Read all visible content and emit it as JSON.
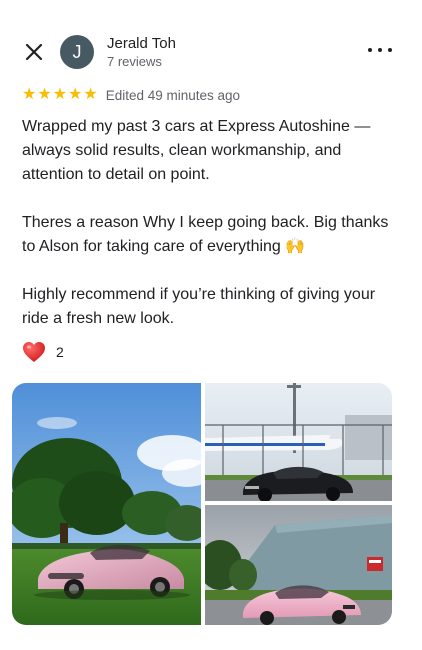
{
  "review": {
    "author": {
      "initial": "J",
      "name": "Jerald Toh",
      "reviews": "7 reviews",
      "avatar_color": "#475a63"
    },
    "rating": 5,
    "star_icons": [
      "★",
      "★",
      "★",
      "★",
      "★"
    ],
    "edited": "Edited 49 minutes ago",
    "paragraphs": [
      "Wrapped my past 3 cars at Express Autoshine — always solid results, clean workmanship, and attention to detail on point.",
      "Theres a reason Why I keep going back. Big thanks to Alson for taking care of everything",
      "Highly recommend if you’re thinking of giving your ride a fresh new look."
    ],
    "paragraph_2_emoji": "🙌",
    "reaction": {
      "icon": "heart-icon",
      "count": "2"
    },
    "photos": [
      {
        "name": "photo-pink-supra-on-grass"
      },
      {
        "name": "photo-black-car-at-airfield"
      },
      {
        "name": "photo-pink-bmw-near-hangar"
      }
    ]
  },
  "icons": {
    "close": "close-icon",
    "more": "more-options-icon",
    "star_color": "#fbbc04",
    "heart_color": "#e53935"
  }
}
